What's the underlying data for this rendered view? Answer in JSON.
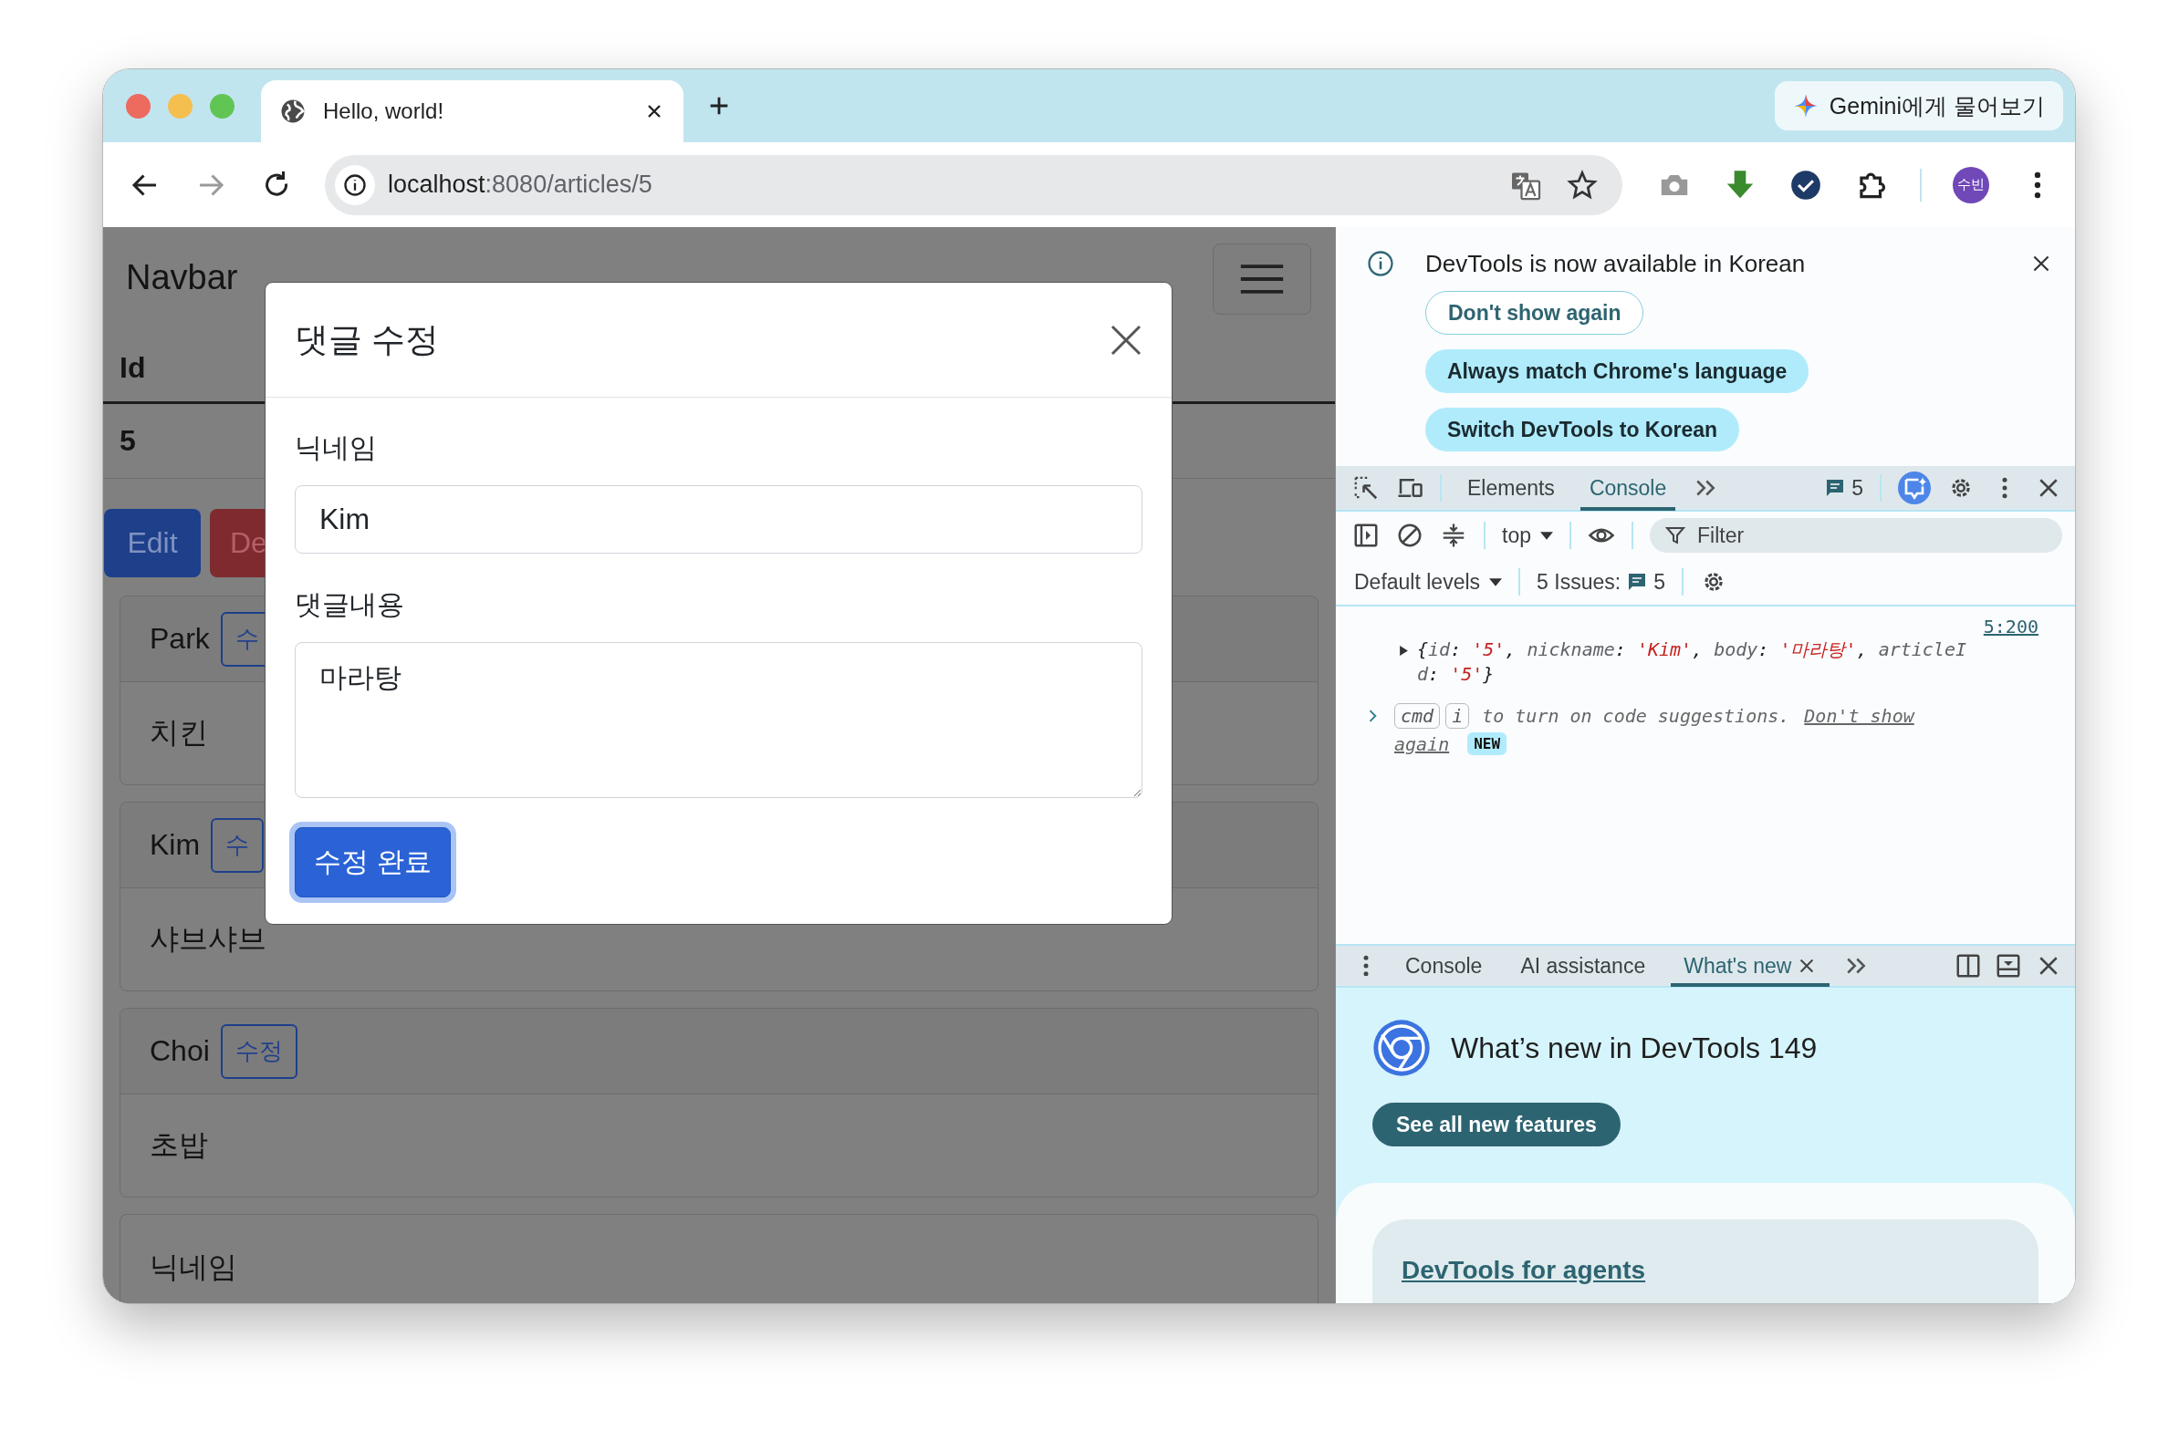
{
  "browser": {
    "tab": {
      "title": "Hello, world!"
    },
    "gemini": "Gemini에게 물어보기",
    "nav": [
      {
        "kind": "back",
        "disabled": false
      },
      {
        "kind": "forward",
        "disabled": true
      },
      {
        "kind": "reload",
        "disabled": false
      }
    ],
    "url": {
      "host": "localhost",
      "rest": ":8080/articles/5"
    },
    "avatar": "수빈"
  },
  "page": {
    "brand": "Navbar",
    "id_header": "Id",
    "id_value": "5",
    "buttons": [
      {
        "label": "Edit",
        "kind": "primary"
      },
      {
        "label": "De",
        "kind": "danger"
      }
    ],
    "comments": [
      {
        "nickname": "Park",
        "button": "수",
        "body": "치킨"
      },
      {
        "nickname": "Kim",
        "button": "수",
        "body": "샤브샤브"
      },
      {
        "nickname": "Choi",
        "button": "수정",
        "body": "초밥"
      }
    ],
    "form_label": "닉네임"
  },
  "modal": {
    "title": "댓글 수정",
    "fields": [
      {
        "label": "닉네임",
        "kind": "input",
        "value": "Kim"
      },
      {
        "label": "댓글내용",
        "kind": "textarea",
        "value": "마라탕"
      }
    ],
    "submit": "수정 완료"
  },
  "devtools": {
    "infobar": {
      "message": "DevTools is now available in Korean",
      "buttons": [
        {
          "label": "Don't show again",
          "kind": "outline"
        },
        {
          "label": "Always match Chrome's language",
          "kind": "filled"
        },
        {
          "label": "Switch DevTools to Korean",
          "kind": "filled"
        }
      ]
    },
    "tabs": [
      {
        "label": "Elements",
        "selected": false
      },
      {
        "label": "Console",
        "selected": true
      }
    ],
    "message_count": "5",
    "context": "top",
    "filter": {
      "placeholder": "Filter"
    },
    "levels": "Default levels",
    "issues": {
      "label": "5 Issues:",
      "count": "5"
    },
    "console": {
      "source": "5:200",
      "object_lines": [
        [
          {
            "text": "{",
            "kind": "punct"
          },
          {
            "text": "id",
            "kind": "key"
          },
          {
            "text": ": ",
            "kind": "punct"
          },
          {
            "text": "'5'",
            "kind": "string"
          },
          {
            "text": ", ",
            "kind": "punct"
          },
          {
            "text": "nickname",
            "kind": "key"
          },
          {
            "text": ": ",
            "kind": "punct"
          },
          {
            "text": "'Kim'",
            "kind": "string"
          },
          {
            "text": ", ",
            "kind": "punct"
          },
          {
            "text": "body",
            "kind": "key"
          },
          {
            "text": ": ",
            "kind": "punct"
          },
          {
            "text": "'마라탕'",
            "kind": "string"
          },
          {
            "text": ", ",
            "kind": "punct"
          },
          {
            "text": "articleI",
            "kind": "key"
          }
        ],
        [
          {
            "text": "d",
            "kind": "key"
          },
          {
            "text": ": ",
            "kind": "punct"
          },
          {
            "text": "'5'",
            "kind": "string"
          },
          {
            "text": "}",
            "kind": "punct"
          }
        ]
      ],
      "hint": {
        "keys": [
          "cmd",
          "i"
        ],
        "text": "to turn on code suggestions.",
        "link": [
          "Don't show",
          "again"
        ],
        "badge": "NEW"
      }
    },
    "drawer": {
      "tabs": [
        {
          "label": "Console",
          "selected": false,
          "closable": false
        },
        {
          "label": "AI assistance",
          "selected": false,
          "closable": false
        },
        {
          "label": "What's new",
          "selected": true,
          "closable": true
        }
      ]
    },
    "whats_new": {
      "title": "What’s new in DevTools 149",
      "button": "See all new features",
      "link": "DevTools for agents"
    }
  }
}
